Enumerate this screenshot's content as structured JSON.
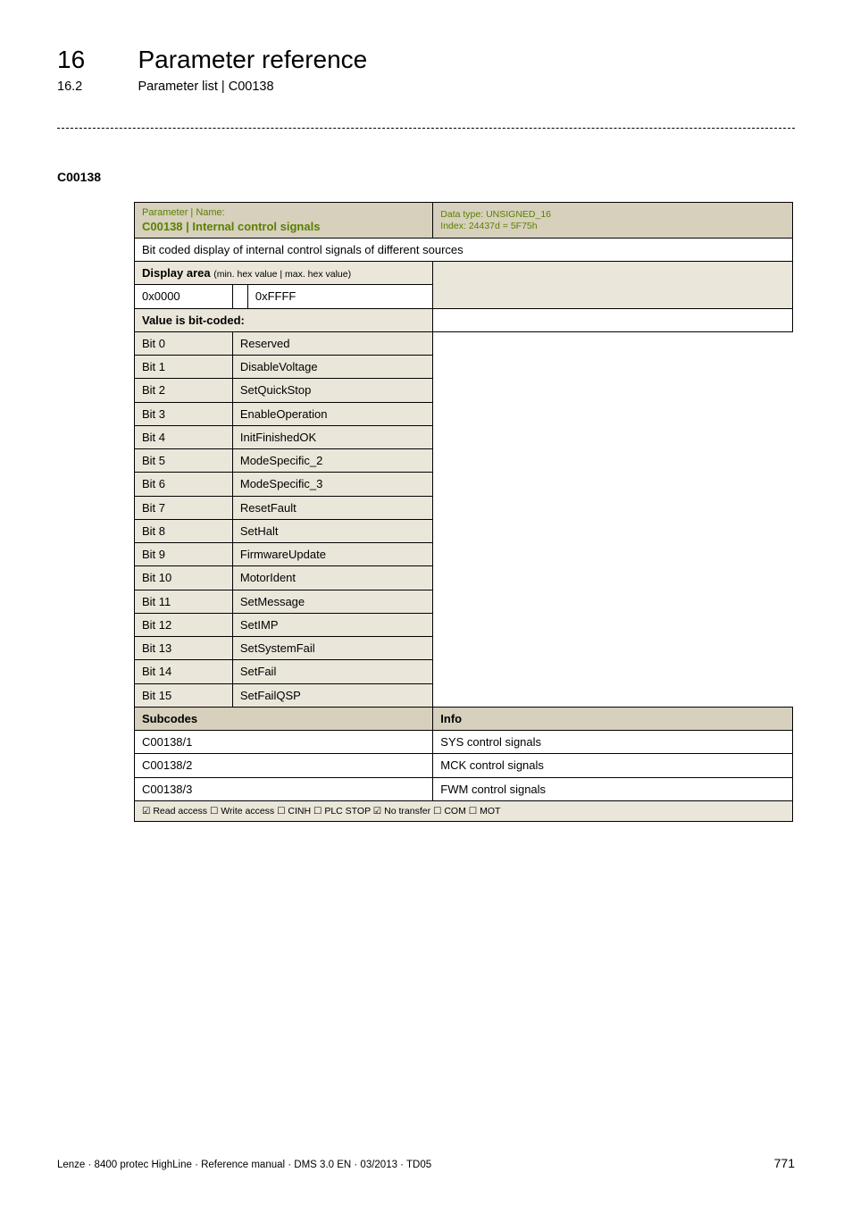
{
  "header": {
    "chapter_num": "16",
    "chapter_title": "Parameter reference",
    "sub_num": "16.2",
    "sub_title": "Parameter list | C00138"
  },
  "param_id": "C00138",
  "table": {
    "hdr_small": "Parameter | Name:",
    "hdr_name": "C00138 | Internal control signals",
    "hdr_right_l1": "Data type: UNSIGNED_16",
    "hdr_right_l2": "Index: 24437d = 5F75h",
    "desc": "Bit coded display of internal control signals of different sources",
    "disp_label": "Display area",
    "disp_small": "(min. hex value | max. hex value)",
    "disp_min": "0x0000",
    "disp_max": "0xFFFF",
    "bitcoded": "Value is bit-coded:",
    "bits": [
      {
        "label": "Bit 0",
        "desc": "Reserved"
      },
      {
        "label": "Bit 1",
        "desc": "DisableVoltage"
      },
      {
        "label": "Bit 2",
        "desc": "SetQuickStop"
      },
      {
        "label": "Bit 3",
        "desc": "EnableOperation"
      },
      {
        "label": "Bit 4",
        "desc": "InitFinishedOK"
      },
      {
        "label": "Bit 5",
        "desc": "ModeSpecific_2"
      },
      {
        "label": "Bit 6",
        "desc": "ModeSpecific_3"
      },
      {
        "label": "Bit 7",
        "desc": "ResetFault"
      },
      {
        "label": "Bit 8",
        "desc": "SetHalt"
      },
      {
        "label": "Bit 9",
        "desc": "FirmwareUpdate"
      },
      {
        "label": "Bit 10",
        "desc": "MotorIdent"
      },
      {
        "label": "Bit 11",
        "desc": "SetMessage"
      },
      {
        "label": "Bit 12",
        "desc": "SetIMP"
      },
      {
        "label": "Bit 13",
        "desc": "SetSystemFail"
      },
      {
        "label": "Bit 14",
        "desc": "SetFail"
      },
      {
        "label": "Bit 15",
        "desc": "SetFailQSP"
      }
    ],
    "subcodes_hdr_l": "Subcodes",
    "subcodes_hdr_r": "Info",
    "subcodes": [
      {
        "l": "C00138/1",
        "r": "SYS control signals"
      },
      {
        "l": "C00138/2",
        "r": "MCK control signals"
      },
      {
        "l": "C00138/3",
        "r": "FWM control signals"
      }
    ],
    "footer_access": "☑ Read access  ☐ Write access  ☐ CINH  ☐ PLC STOP  ☑ No transfer  ☐ COM  ☐ MOT"
  },
  "footer": {
    "left": "Lenze · 8400 protec HighLine · Reference manual · DMS 3.0 EN · 03/2013 · TD05",
    "right": "771"
  }
}
